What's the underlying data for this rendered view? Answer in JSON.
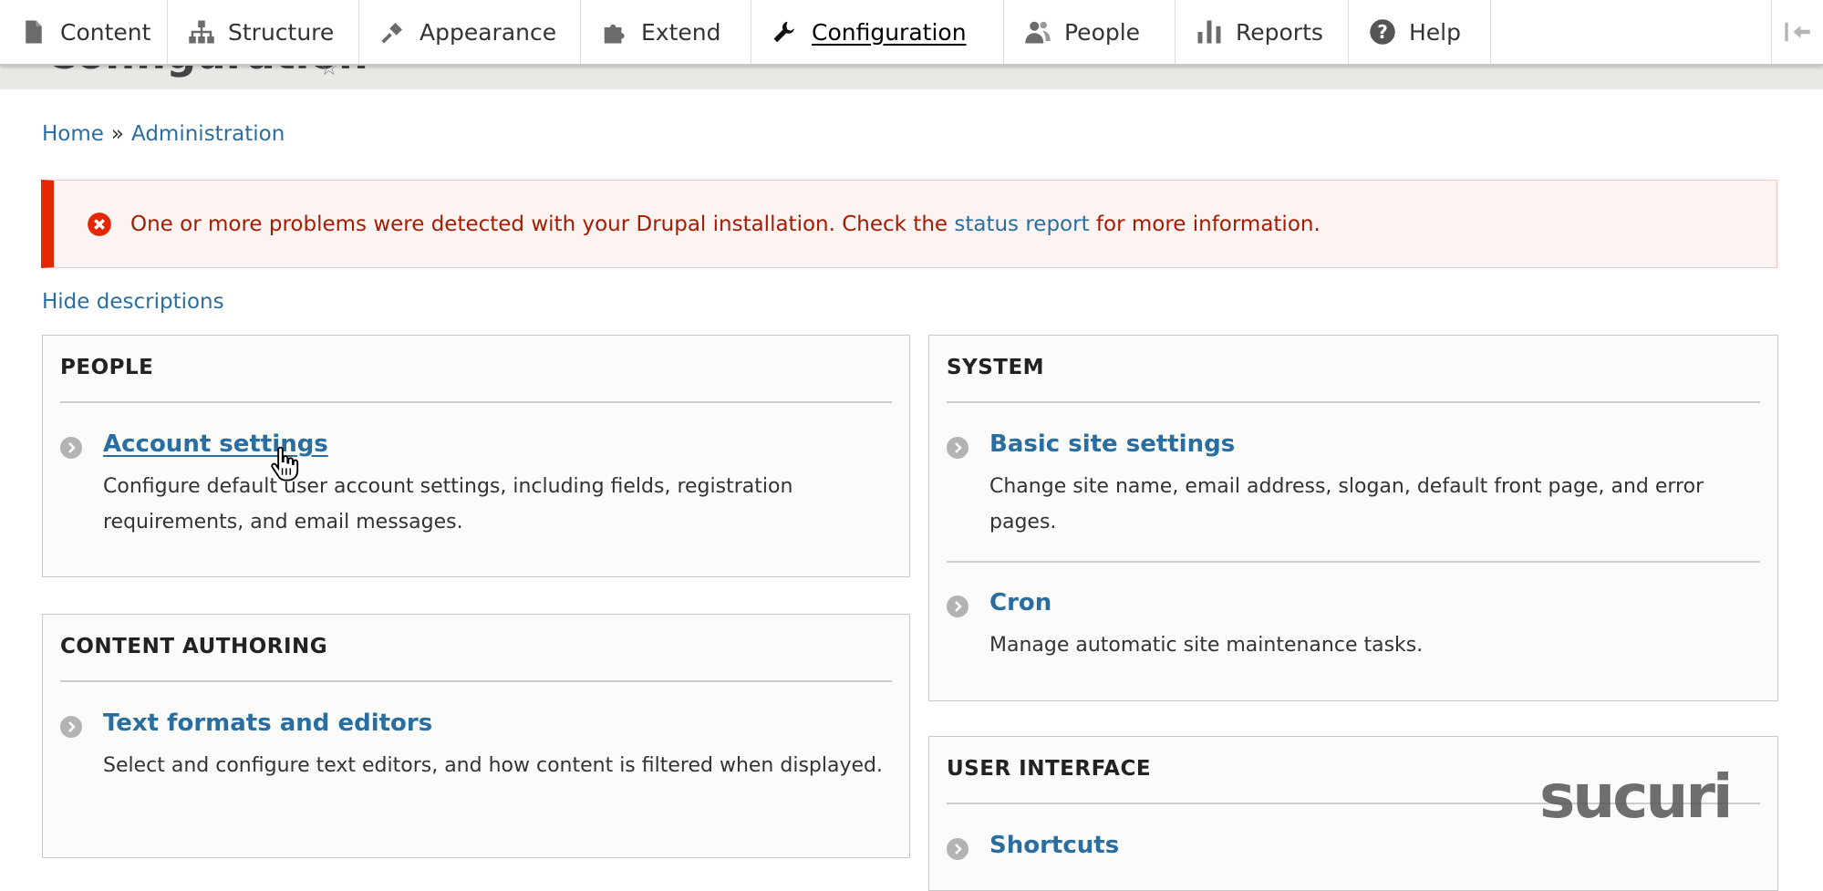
{
  "toolbar": {
    "items": [
      {
        "label": "Content",
        "icon": "page-icon"
      },
      {
        "label": "Structure",
        "icon": "sitemap-icon"
      },
      {
        "label": "Appearance",
        "icon": "paintbrush-icon"
      },
      {
        "label": "Extend",
        "icon": "puzzle-icon"
      },
      {
        "label": "Configuration",
        "icon": "wrench-icon",
        "active": true
      },
      {
        "label": "People",
        "icon": "people-icon"
      },
      {
        "label": "Reports",
        "icon": "bar-chart-icon"
      },
      {
        "label": "Help",
        "icon": "help-icon"
      }
    ]
  },
  "page_title": "Configuration",
  "breadcrumb": {
    "home": "Home",
    "separator": "»",
    "admin": "Administration"
  },
  "alert": {
    "text_before": "One or more problems were detected with your Drupal installation. Check the ",
    "link": "status report",
    "text_after": " for more information."
  },
  "hide_descriptions": "Hide descriptions",
  "panels": {
    "people": {
      "title": "PEOPLE",
      "items": [
        {
          "title": "Account settings",
          "desc": "Configure default user account settings, including fields, registration requirements, and email messages."
        }
      ]
    },
    "content_authoring": {
      "title": "CONTENT AUTHORING",
      "items": [
        {
          "title": "Text formats and editors",
          "desc": "Select and configure text editors, and how content is filtered when displayed."
        }
      ]
    },
    "system": {
      "title": "SYSTEM",
      "items": [
        {
          "title": "Basic site settings",
          "desc": "Change site name, email address, slogan, default front page, and error pages."
        },
        {
          "title": "Cron",
          "desc": "Manage automatic site maintenance tasks."
        }
      ]
    },
    "user_interface": {
      "title": "USER INTERFACE",
      "items": [
        {
          "title": "Shortcuts"
        }
      ]
    }
  },
  "watermark": "sucuri",
  "colors": {
    "link": "#2a6ea0",
    "alert_bar": "#e62600",
    "alert_text": "#a51b00",
    "alert_bg": "#fcf4f2"
  }
}
